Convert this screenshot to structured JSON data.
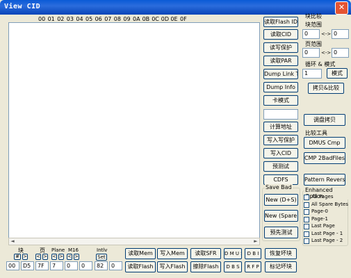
{
  "window": {
    "title": "View CID",
    "close_label": "✕"
  },
  "hex_header": [
    "00",
    "01",
    "02",
    "03",
    "04",
    "05",
    "06",
    "07",
    "08",
    "09",
    "0A",
    "0B",
    "0C",
    "0D",
    "0E",
    "0F"
  ],
  "mid_buttons": {
    "read_flash_id": "读取Flash ID",
    "read_cid": "读取CID",
    "read_protect": "读写保护",
    "read_par": "读取PAR",
    "dump_link_tbl": "Dump Link Tbl",
    "dump_info": "Dump Info",
    "card_mode": "卡模式",
    "calc_addr": "计算地址",
    "write_protect": "写入写保护",
    "write_cid": "写入CID",
    "pretest": "预测试",
    "cdfs": "CDFS"
  },
  "save_bad": {
    "title": "Save Bad",
    "new_ds": "New (D+S)",
    "new_spare": "New (Spare)",
    "pretest2": "预先测试"
  },
  "right_panel": {
    "block_compare": "块比较",
    "block_range": "块范围",
    "block_from": "0",
    "block_arrow": "<->",
    "block_to": "0",
    "page_range": "页范围",
    "page_from": "0",
    "page_arrow": "<->",
    "page_to": "0",
    "loop_mode": "循环 & 模式",
    "loop_count": "1",
    "mode_btn": "模式",
    "copy_compare": "拷贝&比较",
    "adjust_copy": "调盘拷贝",
    "compare_tools": "比较工具",
    "dmus_cmp": "DMUS Cmp",
    "cmp_2bad": "CMP 2BadFiles",
    "pattern_reverse": "Pattern Reverse",
    "enhanced_option": "Enhanced Option",
    "options": [
      "All Pages",
      "All Spare Bytes",
      "Page-0",
      "Page-1",
      "Last Page",
      "Last Page - 1",
      "Last Page - 2"
    ]
  },
  "bottom": {
    "block_lbl": "块",
    "page_lbl": "页",
    "plane_lbl": "Plane",
    "m16_lbl": "M16",
    "intlv_lbl": "Intlv",
    "set_btn": "Set",
    "hash_btn": "#",
    "lt": "<",
    "gt": ">",
    "block_val": "00",
    "page_val": "D5",
    "plane_val": "7F",
    "m16_val": "7",
    "v5": "0",
    "v6": "0",
    "intlv_val": "82",
    "v8": "0",
    "read_mem": "读取Mem",
    "write_mem": "写入Mem",
    "read_sfr": "读取SFR",
    "dmus": "D M U S",
    "dbi": "D B I",
    "restore_block": "恢复坏块",
    "read_flash": "读取Flash",
    "write_flash": "写入Flash",
    "erase_flash": "擦除Flash",
    "dbs": "D B S",
    "rfp": "R F P",
    "mark_bad": "标记坏块"
  }
}
